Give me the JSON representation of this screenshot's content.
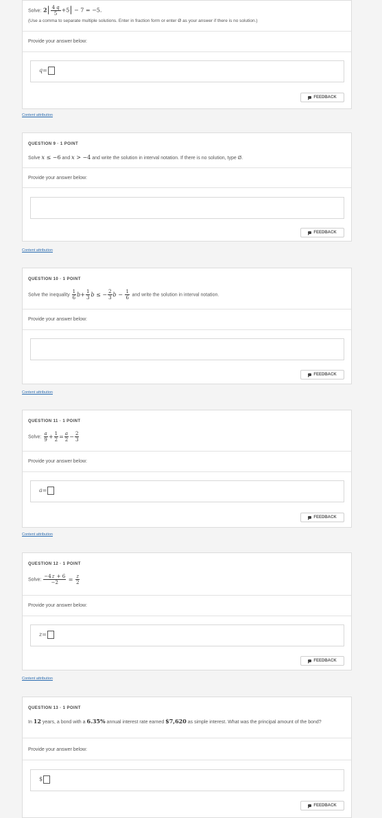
{
  "common": {
    "provide_label": "Provide your answer below:",
    "feedback_label": "FEEDBACK",
    "attribution_label": "Content attribution",
    "point_label": "1 POINT",
    "dot": "·"
  },
  "q8": {
    "solve_prefix": "Solve:",
    "instruction": "(Use a comma to separate multiple solutions. Enter in fraction form or enter Ø as your answer if there is no solution.)",
    "var": "q",
    "eq": "="
  },
  "q9": {
    "heading": "QUESTION 9",
    "prefix": "Solve",
    "mid": "and",
    "suffix": "and write the solution in interval notation. If there is no solution, type Ø."
  },
  "q10": {
    "heading": "QUESTION 10",
    "prefix": "Solve the inequality",
    "suffix": "and write the solution in interval notation."
  },
  "q11": {
    "heading": "QUESTION 11",
    "prefix": "Solve:",
    "var": "a",
    "eq": "="
  },
  "q12": {
    "heading": "QUESTION 12",
    "prefix": "Solve:",
    "var": "z",
    "eq": "="
  },
  "q13": {
    "heading": "QUESTION 13",
    "t1": "In",
    "years": "12",
    "t2": "years, a bond with a",
    "rate": "6.35%",
    "t3": "annual interest rate earned",
    "interest": "$7,620",
    "t4": "as simple interest. What was the principal amount of the bond?",
    "ans_prefix": "$"
  }
}
